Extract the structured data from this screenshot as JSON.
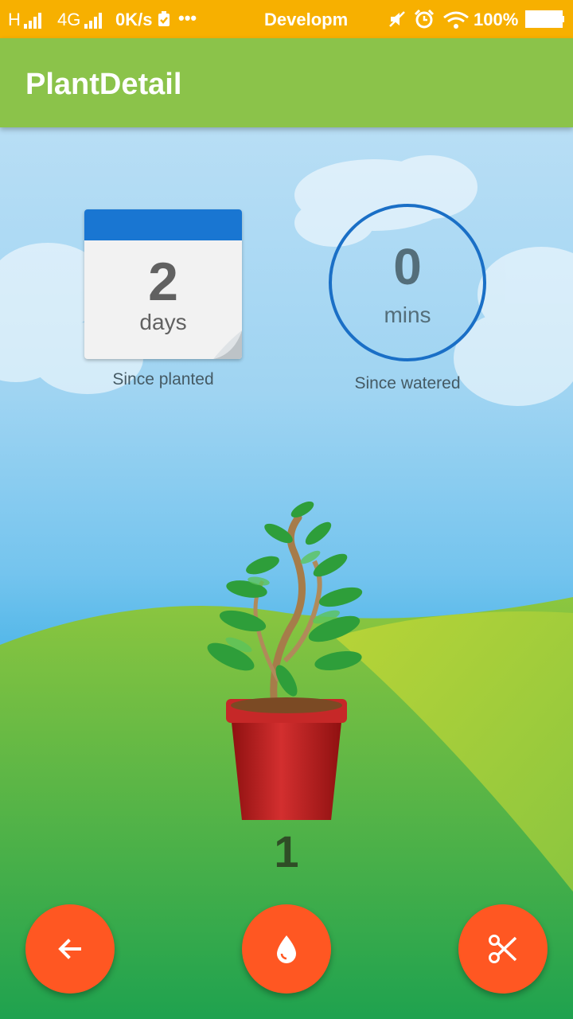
{
  "status_bar": {
    "network_h": "H",
    "network_4g": "4G",
    "speed": "0K/s",
    "overflow": "•••",
    "notification": "Developm",
    "battery": "100%",
    "icons": [
      "signal-icon",
      "signal-icon",
      "check-icon",
      "mute-icon",
      "alarm-icon",
      "wifi-icon",
      "battery-icon"
    ]
  },
  "app_bar": {
    "title": "PlantDetail"
  },
  "planted": {
    "value": "2",
    "unit": "days",
    "caption": "Since planted"
  },
  "watered": {
    "value": "0",
    "unit": "mins",
    "caption": "Since watered"
  },
  "plant": {
    "count": "1"
  },
  "actions": {
    "icons": [
      "arrow-back-icon",
      "water-drop-icon",
      "scissors-icon"
    ]
  },
  "colors": {
    "status_bar": "#f7b000",
    "app_bar": "#8bc34a",
    "accent_blue": "#1976d2",
    "fab": "#ff5722",
    "pot": "#c62828"
  }
}
